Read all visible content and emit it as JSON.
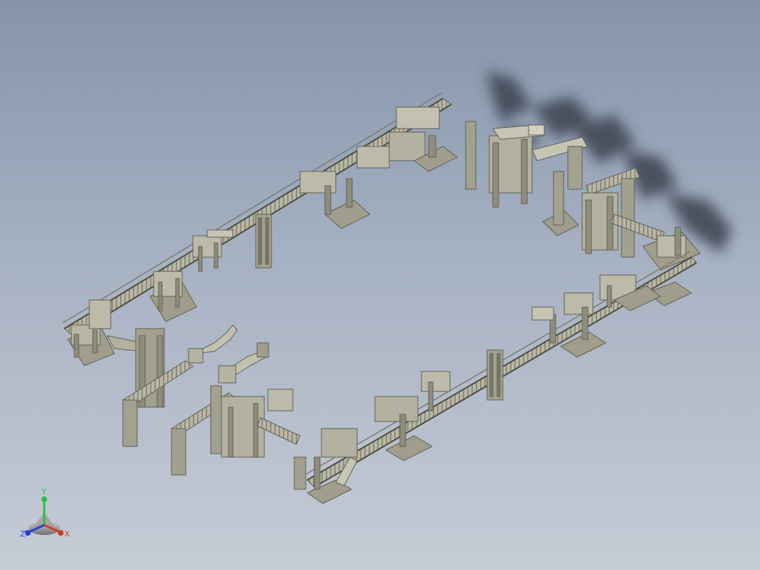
{
  "viewport": {
    "background_top": "#8594ab",
    "background_bottom": "#c6ccd6"
  },
  "model": {
    "description_icon": "assembly-line-model",
    "steel_color": "#a9a897",
    "steel_dark": "#6e6d5e",
    "steel_light": "#cfcebf"
  },
  "view_triad": {
    "x_label": "X",
    "y_label": "Y",
    "z_label": "Z",
    "x_color": "#d23a2a",
    "y_color": "#2fbf3f",
    "z_color": "#2a3fd8"
  }
}
